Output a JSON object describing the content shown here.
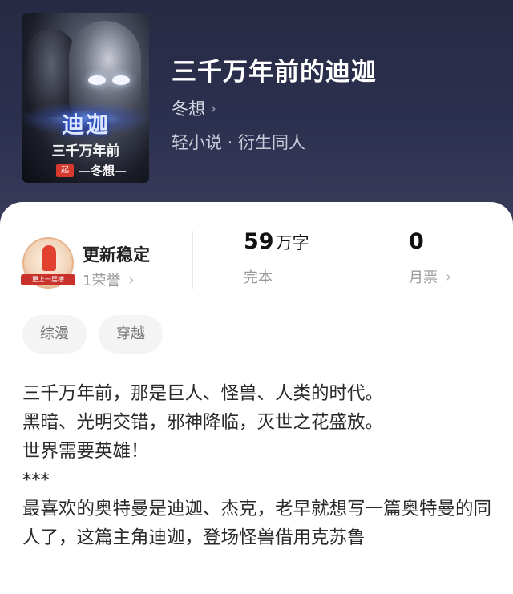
{
  "book": {
    "cover_title": "迪迦",
    "cover_subtitle": "三千万年前",
    "cover_author": "—冬想—",
    "cover_stamp": "起",
    "title": "三千万年前的迪迦",
    "author": "冬想",
    "genre": "轻小说 · 衍生同人"
  },
  "stats": {
    "badge_ribbon": "更上一层楼",
    "honor_label": "更新稳定",
    "honor_sub": "1荣誉",
    "words_value": "59",
    "words_unit": "万字",
    "status": "完本",
    "tickets_value": "0",
    "tickets_label": "月票"
  },
  "tags": [
    "综漫",
    "穿越"
  ],
  "description": "三千万年前，那是巨人、怪兽、人类的时代。\n黑暗、光明交错，邪神降临，灭世之花盛放。\n世界需要英雄！\n***\n最喜欢的奥特曼是迪迦、杰克，老早就想写一篇奥特曼的同人了，这篇主角迪迦，登场怪兽借用克苏鲁",
  "colors": {
    "header_bg": "#2b2e45",
    "card_bg": "#ffffff",
    "tag_bg": "#f4f4f4"
  }
}
